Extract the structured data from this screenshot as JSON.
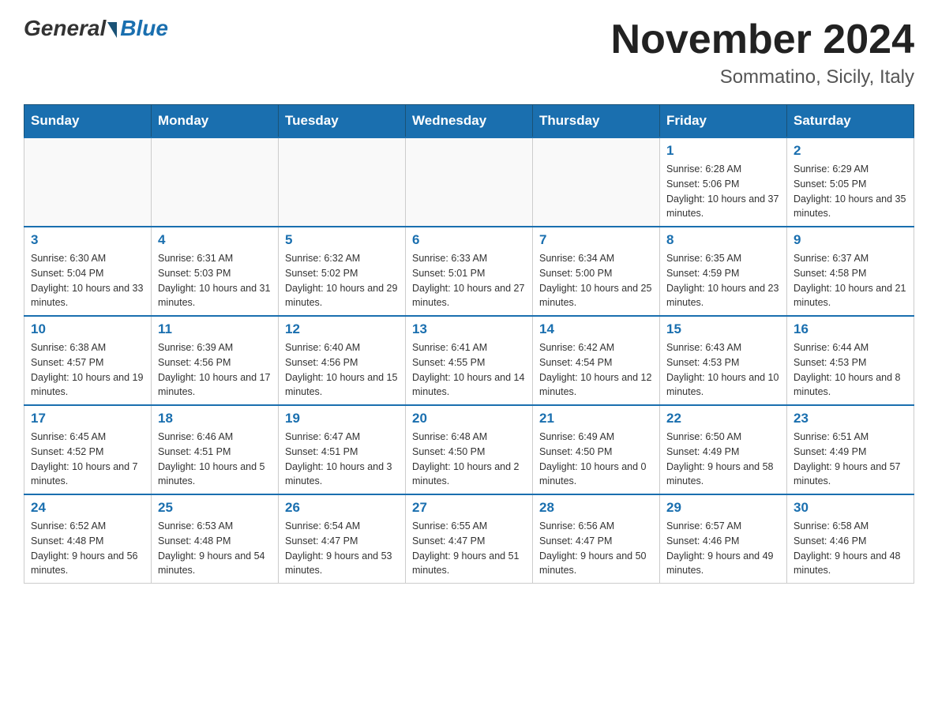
{
  "header": {
    "logo_general": "General",
    "logo_blue": "Blue",
    "month_title": "November 2024",
    "location": "Sommatino, Sicily, Italy"
  },
  "days_of_week": [
    "Sunday",
    "Monday",
    "Tuesday",
    "Wednesday",
    "Thursday",
    "Friday",
    "Saturday"
  ],
  "weeks": [
    [
      {
        "day": "",
        "info": ""
      },
      {
        "day": "",
        "info": ""
      },
      {
        "day": "",
        "info": ""
      },
      {
        "day": "",
        "info": ""
      },
      {
        "day": "",
        "info": ""
      },
      {
        "day": "1",
        "info": "Sunrise: 6:28 AM\nSunset: 5:06 PM\nDaylight: 10 hours and 37 minutes."
      },
      {
        "day": "2",
        "info": "Sunrise: 6:29 AM\nSunset: 5:05 PM\nDaylight: 10 hours and 35 minutes."
      }
    ],
    [
      {
        "day": "3",
        "info": "Sunrise: 6:30 AM\nSunset: 5:04 PM\nDaylight: 10 hours and 33 minutes."
      },
      {
        "day": "4",
        "info": "Sunrise: 6:31 AM\nSunset: 5:03 PM\nDaylight: 10 hours and 31 minutes."
      },
      {
        "day": "5",
        "info": "Sunrise: 6:32 AM\nSunset: 5:02 PM\nDaylight: 10 hours and 29 minutes."
      },
      {
        "day": "6",
        "info": "Sunrise: 6:33 AM\nSunset: 5:01 PM\nDaylight: 10 hours and 27 minutes."
      },
      {
        "day": "7",
        "info": "Sunrise: 6:34 AM\nSunset: 5:00 PM\nDaylight: 10 hours and 25 minutes."
      },
      {
        "day": "8",
        "info": "Sunrise: 6:35 AM\nSunset: 4:59 PM\nDaylight: 10 hours and 23 minutes."
      },
      {
        "day": "9",
        "info": "Sunrise: 6:37 AM\nSunset: 4:58 PM\nDaylight: 10 hours and 21 minutes."
      }
    ],
    [
      {
        "day": "10",
        "info": "Sunrise: 6:38 AM\nSunset: 4:57 PM\nDaylight: 10 hours and 19 minutes."
      },
      {
        "day": "11",
        "info": "Sunrise: 6:39 AM\nSunset: 4:56 PM\nDaylight: 10 hours and 17 minutes."
      },
      {
        "day": "12",
        "info": "Sunrise: 6:40 AM\nSunset: 4:56 PM\nDaylight: 10 hours and 15 minutes."
      },
      {
        "day": "13",
        "info": "Sunrise: 6:41 AM\nSunset: 4:55 PM\nDaylight: 10 hours and 14 minutes."
      },
      {
        "day": "14",
        "info": "Sunrise: 6:42 AM\nSunset: 4:54 PM\nDaylight: 10 hours and 12 minutes."
      },
      {
        "day": "15",
        "info": "Sunrise: 6:43 AM\nSunset: 4:53 PM\nDaylight: 10 hours and 10 minutes."
      },
      {
        "day": "16",
        "info": "Sunrise: 6:44 AM\nSunset: 4:53 PM\nDaylight: 10 hours and 8 minutes."
      }
    ],
    [
      {
        "day": "17",
        "info": "Sunrise: 6:45 AM\nSunset: 4:52 PM\nDaylight: 10 hours and 7 minutes."
      },
      {
        "day": "18",
        "info": "Sunrise: 6:46 AM\nSunset: 4:51 PM\nDaylight: 10 hours and 5 minutes."
      },
      {
        "day": "19",
        "info": "Sunrise: 6:47 AM\nSunset: 4:51 PM\nDaylight: 10 hours and 3 minutes."
      },
      {
        "day": "20",
        "info": "Sunrise: 6:48 AM\nSunset: 4:50 PM\nDaylight: 10 hours and 2 minutes."
      },
      {
        "day": "21",
        "info": "Sunrise: 6:49 AM\nSunset: 4:50 PM\nDaylight: 10 hours and 0 minutes."
      },
      {
        "day": "22",
        "info": "Sunrise: 6:50 AM\nSunset: 4:49 PM\nDaylight: 9 hours and 58 minutes."
      },
      {
        "day": "23",
        "info": "Sunrise: 6:51 AM\nSunset: 4:49 PM\nDaylight: 9 hours and 57 minutes."
      }
    ],
    [
      {
        "day": "24",
        "info": "Sunrise: 6:52 AM\nSunset: 4:48 PM\nDaylight: 9 hours and 56 minutes."
      },
      {
        "day": "25",
        "info": "Sunrise: 6:53 AM\nSunset: 4:48 PM\nDaylight: 9 hours and 54 minutes."
      },
      {
        "day": "26",
        "info": "Sunrise: 6:54 AM\nSunset: 4:47 PM\nDaylight: 9 hours and 53 minutes."
      },
      {
        "day": "27",
        "info": "Sunrise: 6:55 AM\nSunset: 4:47 PM\nDaylight: 9 hours and 51 minutes."
      },
      {
        "day": "28",
        "info": "Sunrise: 6:56 AM\nSunset: 4:47 PM\nDaylight: 9 hours and 50 minutes."
      },
      {
        "day": "29",
        "info": "Sunrise: 6:57 AM\nSunset: 4:46 PM\nDaylight: 9 hours and 49 minutes."
      },
      {
        "day": "30",
        "info": "Sunrise: 6:58 AM\nSunset: 4:46 PM\nDaylight: 9 hours and 48 minutes."
      }
    ]
  ]
}
